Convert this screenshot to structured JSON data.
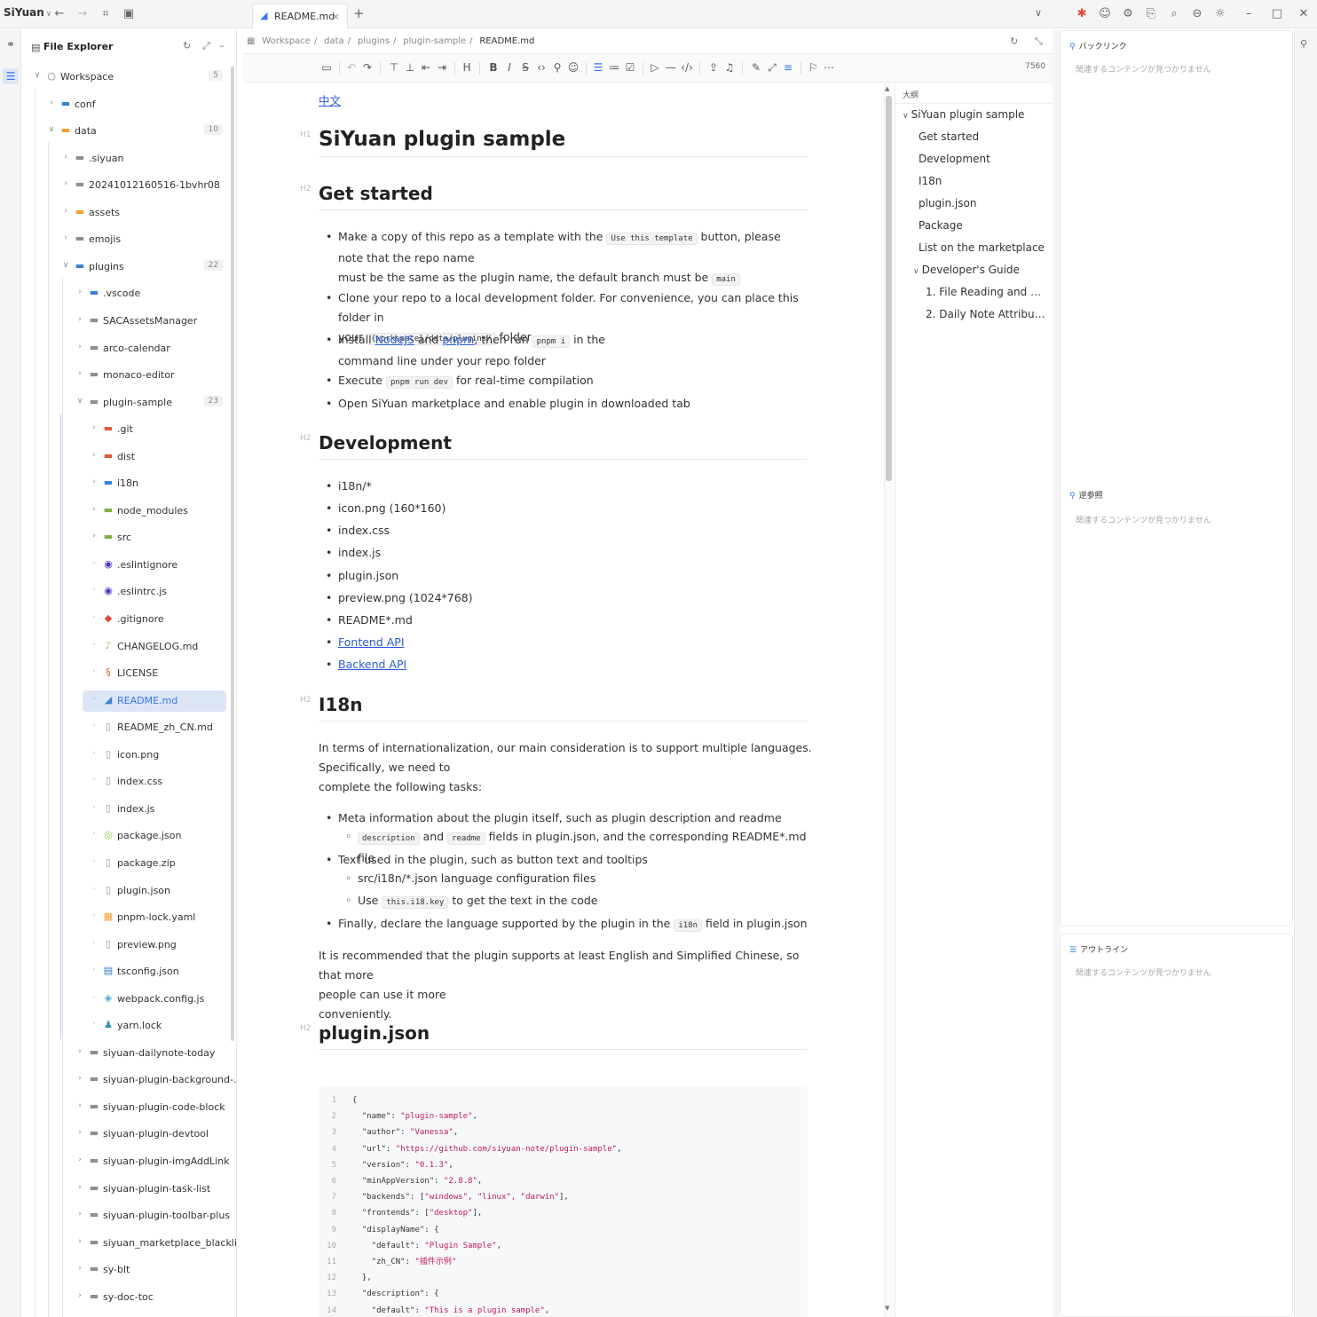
{
  "app": {
    "name": "SiYuan",
    "tab_title": "README.md"
  },
  "titlebar": {
    "left_icons": [
      "back-icon",
      "forward-icon",
      "layout-icon",
      "sync-icon"
    ],
    "right_icons": [
      "bug-icon",
      "user-icon",
      "plugin-icon",
      "export-icon",
      "search-icon",
      "zoom-icon",
      "theme-icon",
      "minimize-icon",
      "maximize-icon",
      "close-icon"
    ]
  },
  "explorer": {
    "title": "File Explorer",
    "items": [
      {
        "name": "Workspace",
        "depth": 0,
        "type": "root",
        "expanded": true,
        "count": "5"
      },
      {
        "name": "conf",
        "depth": 1,
        "type": "folder-blue",
        "expanded": false
      },
      {
        "name": "data",
        "depth": 1,
        "type": "folder-orange",
        "expanded": true,
        "count": "10"
      },
      {
        "name": ".siyuan",
        "depth": 2,
        "type": "folder",
        "expanded": false
      },
      {
        "name": "20241012160516-1bvhr08",
        "depth": 2,
        "type": "folder",
        "expanded": false
      },
      {
        "name": "assets",
        "depth": 2,
        "type": "folder-orange",
        "expanded": false
      },
      {
        "name": "emojis",
        "depth": 2,
        "type": "folder",
        "expanded": false
      },
      {
        "name": "plugins",
        "depth": 2,
        "type": "folder-blue",
        "expanded": true,
        "count": "22"
      },
      {
        "name": ".vscode",
        "depth": 3,
        "type": "folder-blue",
        "expanded": false
      },
      {
        "name": "SACAssetsManager",
        "depth": 3,
        "type": "folder",
        "expanded": false
      },
      {
        "name": "arco-calendar",
        "depth": 3,
        "type": "folder",
        "expanded": false
      },
      {
        "name": "monaco-editor",
        "depth": 3,
        "type": "folder",
        "expanded": false
      },
      {
        "name": "plugin-sample",
        "depth": 3,
        "type": "folder",
        "expanded": true,
        "count": "23"
      },
      {
        "name": ".git",
        "depth": 4,
        "type": "folder-red",
        "expanded": false
      },
      {
        "name": "dist",
        "depth": 4,
        "type": "folder-red",
        "expanded": false
      },
      {
        "name": "i18n",
        "depth": 4,
        "type": "folder-blue",
        "expanded": false
      },
      {
        "name": "node_modules",
        "depth": 4,
        "type": "folder-green",
        "expanded": false
      },
      {
        "name": "src",
        "depth": 4,
        "type": "folder-green",
        "expanded": false
      },
      {
        "name": ".eslintignore",
        "depth": 4,
        "type": "file-eslint"
      },
      {
        "name": ".eslintrc.js",
        "depth": 4,
        "type": "file-eslint"
      },
      {
        "name": ".gitignore",
        "depth": 4,
        "type": "file-git"
      },
      {
        "name": "CHANGELOG.md",
        "depth": 4,
        "type": "file-changelog"
      },
      {
        "name": "LICENSE",
        "depth": 4,
        "type": "file-license"
      },
      {
        "name": "README.md",
        "depth": 4,
        "type": "file-readme",
        "selected": true
      },
      {
        "name": "README_zh_CN.md",
        "depth": 4,
        "type": "file"
      },
      {
        "name": "icon.png",
        "depth": 4,
        "type": "file"
      },
      {
        "name": "index.css",
        "depth": 4,
        "type": "file"
      },
      {
        "name": "index.js",
        "depth": 4,
        "type": "file"
      },
      {
        "name": "package.json",
        "depth": 4,
        "type": "file-npm"
      },
      {
        "name": "package.zip",
        "depth": 4,
        "type": "file"
      },
      {
        "name": "plugin.json",
        "depth": 4,
        "type": "file"
      },
      {
        "name": "pnpm-lock.yaml",
        "depth": 4,
        "type": "file-pnpm"
      },
      {
        "name": "preview.png",
        "depth": 4,
        "type": "file"
      },
      {
        "name": "tsconfig.json",
        "depth": 4,
        "type": "file-ts"
      },
      {
        "name": "webpack.config.js",
        "depth": 4,
        "type": "file-webpack"
      },
      {
        "name": "yarn.lock",
        "depth": 4,
        "type": "file-yarn"
      },
      {
        "name": "siyuan-dailynote-today",
        "depth": 3,
        "type": "folder",
        "expanded": false
      },
      {
        "name": "siyuan-plugin-background-...",
        "depth": 3,
        "type": "folder",
        "expanded": false
      },
      {
        "name": "siyuan-plugin-code-block",
        "depth": 3,
        "type": "folder",
        "expanded": false
      },
      {
        "name": "siyuan-plugin-devtool",
        "depth": 3,
        "type": "folder",
        "expanded": false
      },
      {
        "name": "siyuan-plugin-imgAddLink",
        "depth": 3,
        "type": "folder",
        "expanded": false
      },
      {
        "name": "siyuan-plugin-task-list",
        "depth": 3,
        "type": "folder",
        "expanded": false
      },
      {
        "name": "siyuan-plugin-toolbar-plus",
        "depth": 3,
        "type": "folder",
        "expanded": false
      },
      {
        "name": "siyuan_marketplace_blacklist",
        "depth": 3,
        "type": "folder",
        "expanded": false
      },
      {
        "name": "sy-blt",
        "depth": 3,
        "type": "folder",
        "expanded": false
      },
      {
        "name": "sy-doc-toc",
        "depth": 3,
        "type": "folder",
        "expanded": false
      }
    ]
  },
  "breadcrumb": [
    "Workspace",
    "data",
    "plugins",
    "plugin-sample",
    "README.md"
  ],
  "toolbar": {
    "word_count": "7560"
  },
  "doc": {
    "lang_link": "中文",
    "h1_mark": "H1",
    "h2_mark": "H2",
    "title": "SiYuan plugin sample",
    "get_started": {
      "heading": "Get started",
      "li1_a": "Make a copy of this repo as a template with the ",
      "li1_code": "Use this template",
      "li1_b": " button, please note that the repo name",
      "li1_c": "must be the same as the plugin name, the default branch must be ",
      "li1_code2": "main",
      "li2_a": "Clone your repo to a local development folder. For convenience, you can place this folder in",
      "li2_b": "your ",
      "li2_code": "{workspace}/data/plugins/",
      "li2_c": " folder",
      "li3_a": "Install ",
      "li3_link1": "NodeJS",
      "li3_b": " and ",
      "li3_link2": "pnpm",
      "li3_c": ", then run ",
      "li3_code": "pnpm i",
      "li3_d": " in the",
      "li3_e": "command line under your repo folder",
      "li4_a": "Execute ",
      "li4_code": "pnpm run dev",
      "li4_b": " for real-time compilation",
      "li5": "Open SiYuan marketplace and enable plugin in downloaded tab"
    },
    "development": {
      "heading": "Development",
      "items": [
        "i18n/*",
        "icon.png (160*160)",
        "index.css",
        "index.js",
        "plugin.json",
        "preview.png (1024*768)",
        "README*.md"
      ],
      "link1": "Fontend API",
      "link2": "Backend API"
    },
    "i18n": {
      "heading": "I18n",
      "p1_a": "In terms of internationalization, our main consideration is to support multiple languages.",
      "p1_b": "Specifically, we need to",
      "p1_c": "complete the following tasks:",
      "li1": "Meta information about the plugin itself, such as plugin description and readme",
      "li1_sub_code1": "description",
      "li1_sub_a": " and ",
      "li1_sub_code2": "readme",
      "li1_sub_b": " fields in plugin.json, and the corresponding README*.md file",
      "li2": "Text used in the plugin, such as button text and tooltips",
      "li2_sub1": "src/i18n/*.json language configuration files",
      "li2_sub2_a": "Use ",
      "li2_sub2_code": "this.i18.key",
      "li2_sub2_b": " to get the text in the code",
      "li3_a": "Finally, declare the language supported by the plugin in the ",
      "li3_code": "i18n",
      "li3_b": " field in plugin.json",
      "p2_a": "It is recommended that the plugin supports at least English and Simplified Chinese, so that more",
      "p2_b": "people can use it more",
      "p2_c": "conveniently."
    },
    "plugin_json": {
      "heading": "plugin.json",
      "code_lines": [
        {
          "n": "1",
          "k": "{",
          "v": ""
        },
        {
          "n": "2",
          "k": "  \"name\": ",
          "v": "\"plugin-sample\"",
          "t": ","
        },
        {
          "n": "3",
          "k": "  \"author\": ",
          "v": "\"Vanessa\"",
          "t": ","
        },
        {
          "n": "4",
          "k": "  \"url\": ",
          "v": "\"https://github.com/siyuan-note/plugin-sample\"",
          "t": ","
        },
        {
          "n": "5",
          "k": "  \"version\": ",
          "v": "\"0.1.3\"",
          "t": ","
        },
        {
          "n": "6",
          "k": "  \"minAppVersion\": ",
          "v": "\"2.8.8\"",
          "t": ","
        },
        {
          "n": "7",
          "k": "  \"backends\": [",
          "v": "\"windows\", \"linux\", \"darwin\"",
          "t": "],"
        },
        {
          "n": "8",
          "k": "  \"frontends\": [",
          "v": "\"desktop\"",
          "t": "],"
        },
        {
          "n": "9",
          "k": "  \"displayName\": {",
          "v": "",
          "t": ""
        },
        {
          "n": "10",
          "k": "    \"default\": ",
          "v": "\"Plugin Sample\"",
          "t": ","
        },
        {
          "n": "11",
          "k": "    \"zh_CN\": ",
          "v": "\"插件示例\"",
          "t": ""
        },
        {
          "n": "12",
          "k": "  },",
          "v": "",
          "t": ""
        },
        {
          "n": "13",
          "k": "  \"description\": {",
          "v": "",
          "t": ""
        },
        {
          "n": "14",
          "k": "    \"default\": ",
          "v": "\"This is a plugin sample\"",
          "t": ","
        }
      ]
    }
  },
  "outline": {
    "title": "大纲",
    "items": [
      {
        "label": "SiYuan plugin sample",
        "level": 0,
        "arrow": true
      },
      {
        "label": "Get started",
        "level": 1
      },
      {
        "label": "Development",
        "level": 1
      },
      {
        "label": "I18n",
        "level": 1
      },
      {
        "label": "plugin.json",
        "level": 1
      },
      {
        "label": "Package",
        "level": 1
      },
      {
        "label": "List on the marketplace",
        "level": 1
      },
      {
        "label": "Developer's Guide",
        "level": 1,
        "arrow": true
      },
      {
        "label": "1. File Reading and W...",
        "level": 2
      },
      {
        "label": "2. Daily Note Attribut...",
        "level": 2
      }
    ]
  },
  "panels": {
    "backlinks": {
      "title": "バックリンク",
      "empty": "関連するコンテンツが見つかりません"
    },
    "mentions": {
      "title": "逆参照",
      "empty": "関連するコンテンツが見つかりません"
    },
    "outline": {
      "title": "アウトライン",
      "empty": "関連するコンテンツが見つかりません"
    }
  },
  "colors": {
    "accent": "#3575f0",
    "link": "#2a5bd7",
    "selected_bg": "#dde6f7",
    "code_string": "#c2185b"
  }
}
